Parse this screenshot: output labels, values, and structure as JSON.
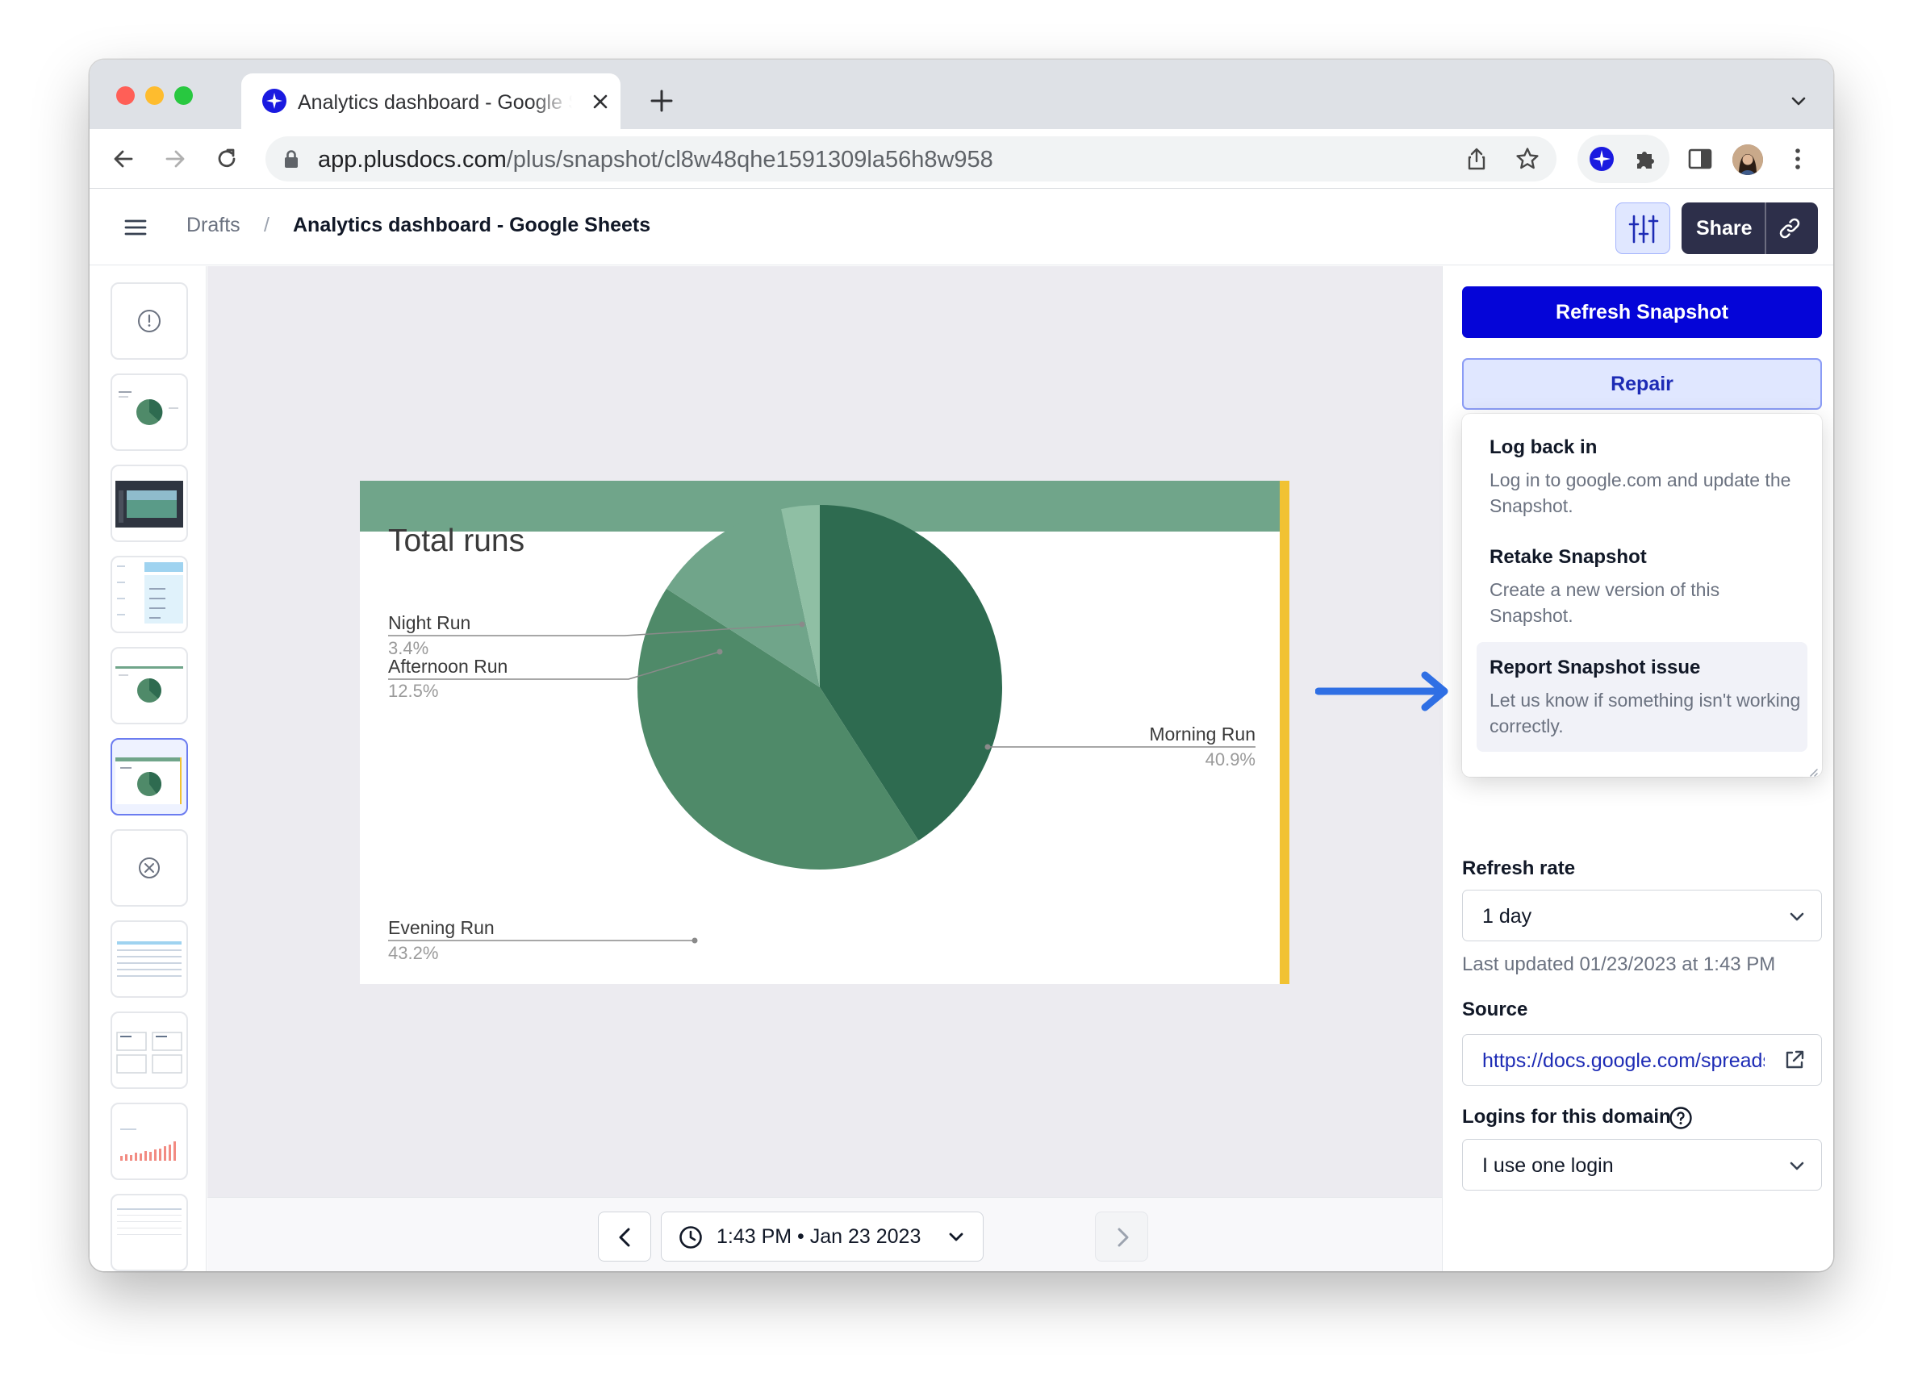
{
  "browser": {
    "tab_title": "Analytics dashboard - Google Sheets",
    "url_host": "app.plusdocs.com",
    "url_path": "/plus/snapshot/cl8w48qhe1591309la56h8w958"
  },
  "header": {
    "breadcrumb_root": "Drafts",
    "breadcrumb_separator": "/",
    "title": "Analytics dashboard - Google Sheets",
    "share_label": "Share"
  },
  "chart_data": {
    "type": "pie",
    "title": "Total runs",
    "slices": [
      {
        "label": "Morning Run",
        "pct_label": "40.9%",
        "value": 40.9,
        "color": "#2e6b50"
      },
      {
        "label": "Evening Run",
        "pct_label": "43.2%",
        "value": 43.2,
        "color": "#4f8a69"
      },
      {
        "label": "Afternoon Run",
        "pct_label": "12.5%",
        "value": 12.5,
        "color": "#70a58a"
      },
      {
        "label": "Night Run",
        "pct_label": "3.4%",
        "value": 3.4,
        "color": "#8fbfa4"
      }
    ]
  },
  "bottom": {
    "timestamp": "1:43 PM • Jan 23 2023"
  },
  "panel": {
    "refresh_label": "Refresh Snapshot",
    "repair_label": "Repair",
    "repair_menu": [
      {
        "title": "Log back in",
        "desc": "Log in to google.com and update the Snapshot."
      },
      {
        "title": "Retake Snapshot",
        "desc": "Create a new version of this Snapshot."
      },
      {
        "title": "Report Snapshot issue",
        "desc": "Let us know if something isn't working correctly."
      }
    ],
    "refresh_rate_label": "Refresh rate",
    "refresh_rate_value": "1 day",
    "last_updated": "Last updated 01/23/2023 at 1:43 PM",
    "source_label": "Source",
    "source_url": "https://docs.google.com/spreadsheets",
    "logins_label": "Logins for this domain",
    "logins_value": "I use one login"
  },
  "colors": {
    "accent": "#0505d8",
    "slide_band": "#70a58a",
    "slide_edge": "#f1c232",
    "arrow": "#2f6fe4"
  }
}
